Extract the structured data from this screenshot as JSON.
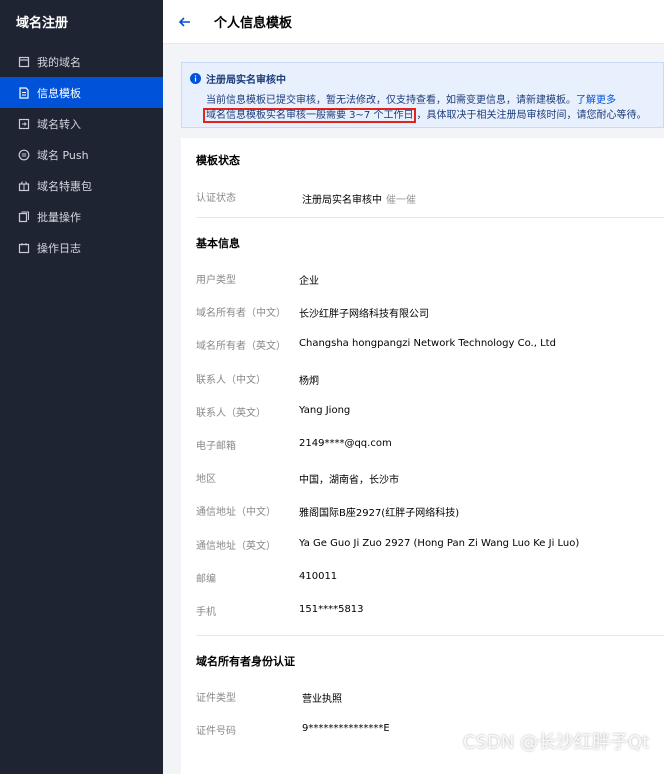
{
  "sidebar": {
    "title": "域名注册",
    "items": [
      {
        "label": "我的域名",
        "icon": "domain-list-icon",
        "active": false
      },
      {
        "label": "信息模板",
        "icon": "template-icon",
        "active": true
      },
      {
        "label": "域名转入",
        "icon": "transfer-icon",
        "active": false
      },
      {
        "label": "域名 Push",
        "icon": "push-icon",
        "active": false
      },
      {
        "label": "域名特惠包",
        "icon": "gift-package-icon",
        "active": false
      },
      {
        "label": "批量操作",
        "icon": "batch-icon",
        "active": false
      },
      {
        "label": "操作日志",
        "icon": "calendar-log-icon",
        "active": false
      }
    ]
  },
  "header": {
    "title": "个人信息模板"
  },
  "notice": {
    "title": "注册局实名审核中",
    "line1": "当前信息模板已提交审核，暂无法修改，仅支持查看，如需变更信息，请新建模板。",
    "learn_more": "了解更多",
    "highlight": "域名信息模板实名审核一般需要 3~7 个工作日",
    "line2_rest": "，具体取决于相关注册局审核时间，请您耐心等待。"
  },
  "template_status": {
    "title": "模板状态",
    "label": "认证状态",
    "value": "注册局实名审核中",
    "action": "催一催"
  },
  "basic_info": {
    "title": "基本信息",
    "rows": [
      {
        "label": "用户类型",
        "value": "企业"
      },
      {
        "label": "域名所有者（中文）",
        "value": "长沙红胖子网络科技有限公司"
      },
      {
        "label": "域名所有者（英文）",
        "value": "Changsha hongpangzi Network Technology Co., Ltd"
      },
      {
        "label": "联系人（中文）",
        "value": "杨炯"
      },
      {
        "label": "联系人（英文）",
        "value": "Yang Jiong"
      },
      {
        "label": "电子邮箱",
        "value": "2149****@qq.com"
      },
      {
        "label": "地区",
        "value": "中国，湖南省，长沙市"
      },
      {
        "label": "通信地址（中文）",
        "value": "雅阁国际B座2927(红胖子网络科技)"
      },
      {
        "label": "通信地址（英文）",
        "value": "Ya Ge Guo Ji Zuo 2927 (Hong Pan Zi Wang Luo Ke Ji Luo)"
      },
      {
        "label": "邮编",
        "value": "410011"
      },
      {
        "label": "手机",
        "value": "151****5813"
      }
    ]
  },
  "identity": {
    "title": "域名所有者身份认证",
    "rows": [
      {
        "label": "证件类型",
        "value": "营业执照"
      },
      {
        "label": "证件号码",
        "value": "9***************E"
      }
    ]
  },
  "watermark": "CSDN @长沙红胖子Qt",
  "colors": {
    "sidebar_bg": "#1f2433",
    "active_item": "#0052d9",
    "notice_bg": "#e8f0fd",
    "highlight_border": "#e0251b",
    "link": "#0052d9"
  }
}
